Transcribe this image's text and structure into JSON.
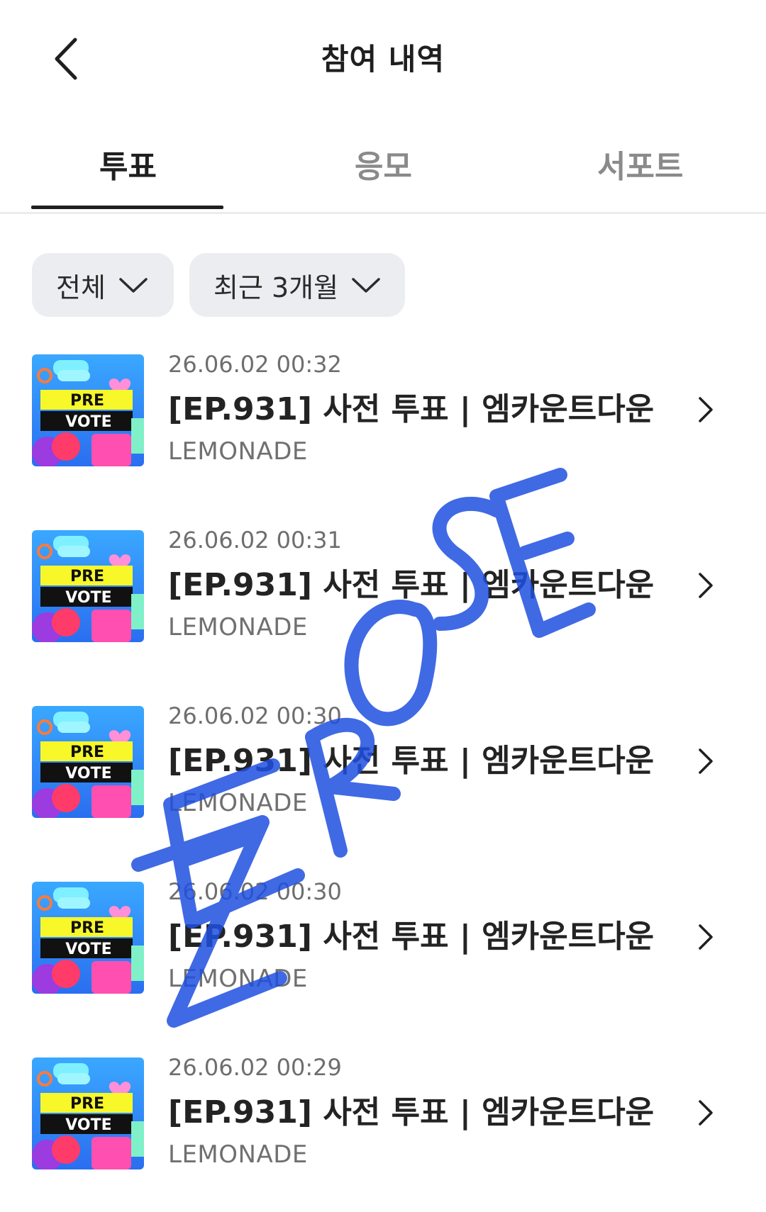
{
  "header": {
    "title": "참여 내역",
    "back_icon": "chevron-left-icon"
  },
  "tabs": [
    {
      "label": "투표",
      "active": true
    },
    {
      "label": "응모",
      "active": false
    },
    {
      "label": "서포트",
      "active": false
    }
  ],
  "filters": {
    "category": "전체",
    "period": "최근 3개월",
    "dropdown_icon": "chevron-down-icon"
  },
  "items": [
    {
      "date": "26.06.02 00:32",
      "title": "[EP.931] 사전 투표 | 엠카운트다운",
      "brand": "LEMONADE",
      "thumb_text_1": "PRE",
      "thumb_text_2": "VOTE"
    },
    {
      "date": "26.06.02 00:31",
      "title": "[EP.931] 사전 투표 | 엠카운트다운",
      "brand": "LEMONADE",
      "thumb_text_1": "PRE",
      "thumb_text_2": "VOTE"
    },
    {
      "date": "26.06.02 00:30",
      "title": "[EP.931] 사전 투표 | 엠카운트다운",
      "brand": "LEMONADE",
      "thumb_text_1": "PRE",
      "thumb_text_2": "VOTE"
    },
    {
      "date": "26.06.02 00:30",
      "title": "[EP.931] 사전 투표 | 엠카운트다운",
      "brand": "LEMONADE",
      "thumb_text_1": "PRE",
      "thumb_text_2": "VOTE"
    },
    {
      "date": "26.06.02 00:29",
      "title": "[EP.931] 사전 투표 | 엠카운트다운",
      "brand": "LEMONADE",
      "thumb_text_1": "PRE",
      "thumb_text_2": "VOTE"
    }
  ],
  "watermark": {
    "text": "ZEROSE",
    "color": "#1f4fe0"
  },
  "colors": {
    "chip_bg": "#ebedf0",
    "active_tab": "#1f1f1f",
    "inactive_tab": "#8a8a8a"
  }
}
